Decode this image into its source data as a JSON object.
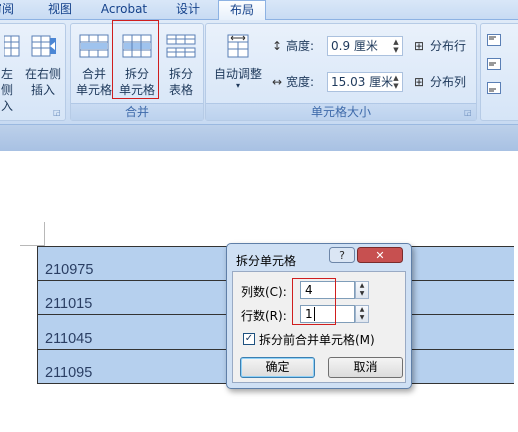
{
  "tabs": [
    {
      "label": "审阅",
      "shown": "审阅"
    },
    {
      "label": "视图"
    },
    {
      "label": "Acrobat"
    },
    {
      "label": "设计"
    },
    {
      "label": "布局"
    }
  ],
  "tab_fragment": "审阅",
  "ribbon": {
    "insert_group": {
      "left_label_l1": "左侧",
      "left_label_l2": "入",
      "right_label_l1": "在右侧",
      "right_label_l2": "插入"
    },
    "merge_group": {
      "label": "合并",
      "merge_cells": [
        "合并",
        "单元格"
      ],
      "split_cells": [
        "拆分",
        "单元格"
      ],
      "split_table": [
        "拆分",
        "表格"
      ]
    },
    "cell_size_group": {
      "label": "单元格大小",
      "autofit": "自动调整",
      "height_label": "高度:",
      "height_value": "0.9 厘米",
      "width_label": "宽度:",
      "width_value": "15.03 厘米",
      "distribute_rows": "分布行",
      "distribute_cols": "分布列"
    }
  },
  "table_rows": [
    "210975",
    "211015",
    "211045",
    "211095"
  ],
  "dialog": {
    "title": "拆分单元格",
    "help": "?",
    "close": "✕",
    "cols_label": "列数(C):",
    "cols_value": "4",
    "rows_label": "行数(R):",
    "rows_value": "1",
    "merge_before_split": "拆分前合并单元格(M)",
    "merge_before_split_checked": true,
    "ok": "确定",
    "cancel": "取消"
  },
  "colors": {
    "highlight": "#d01e1e",
    "table_fill": "#b6d0ee",
    "ribbon": "#d4e3f6"
  }
}
